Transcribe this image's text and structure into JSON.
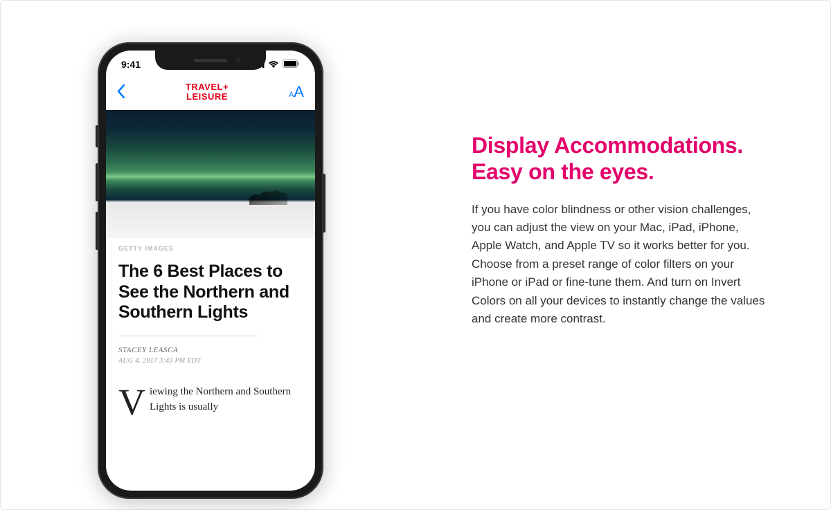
{
  "phone": {
    "status": {
      "time": "9:41"
    },
    "nav": {
      "brand_line1": "TRAVEL+",
      "brand_line2": "LEISURE"
    },
    "article": {
      "image_credit": "GETTY IMAGES",
      "headline": "The 6 Best Places to See the Northern and Southern Lights",
      "author": "STACEY LEASCA",
      "date": "AUG 4, 2017 3:43 PM EDT",
      "drop_cap": "V",
      "body_text": "iewing the Northern and Southern Lights is usually"
    }
  },
  "feature": {
    "title_line1": "Display Accommodations.",
    "title_line2": "Easy on the eyes.",
    "body": "If you have color blindness or other vision challenges, you can adjust the view on your Mac, iPad, iPhone, Apple Watch, and Apple TV so it works better for you. Choose from a preset range of color filters on your iPhone or iPad or fine-tune them. And turn on Invert Colors on all your devices to instantly change the values and create more contrast."
  }
}
